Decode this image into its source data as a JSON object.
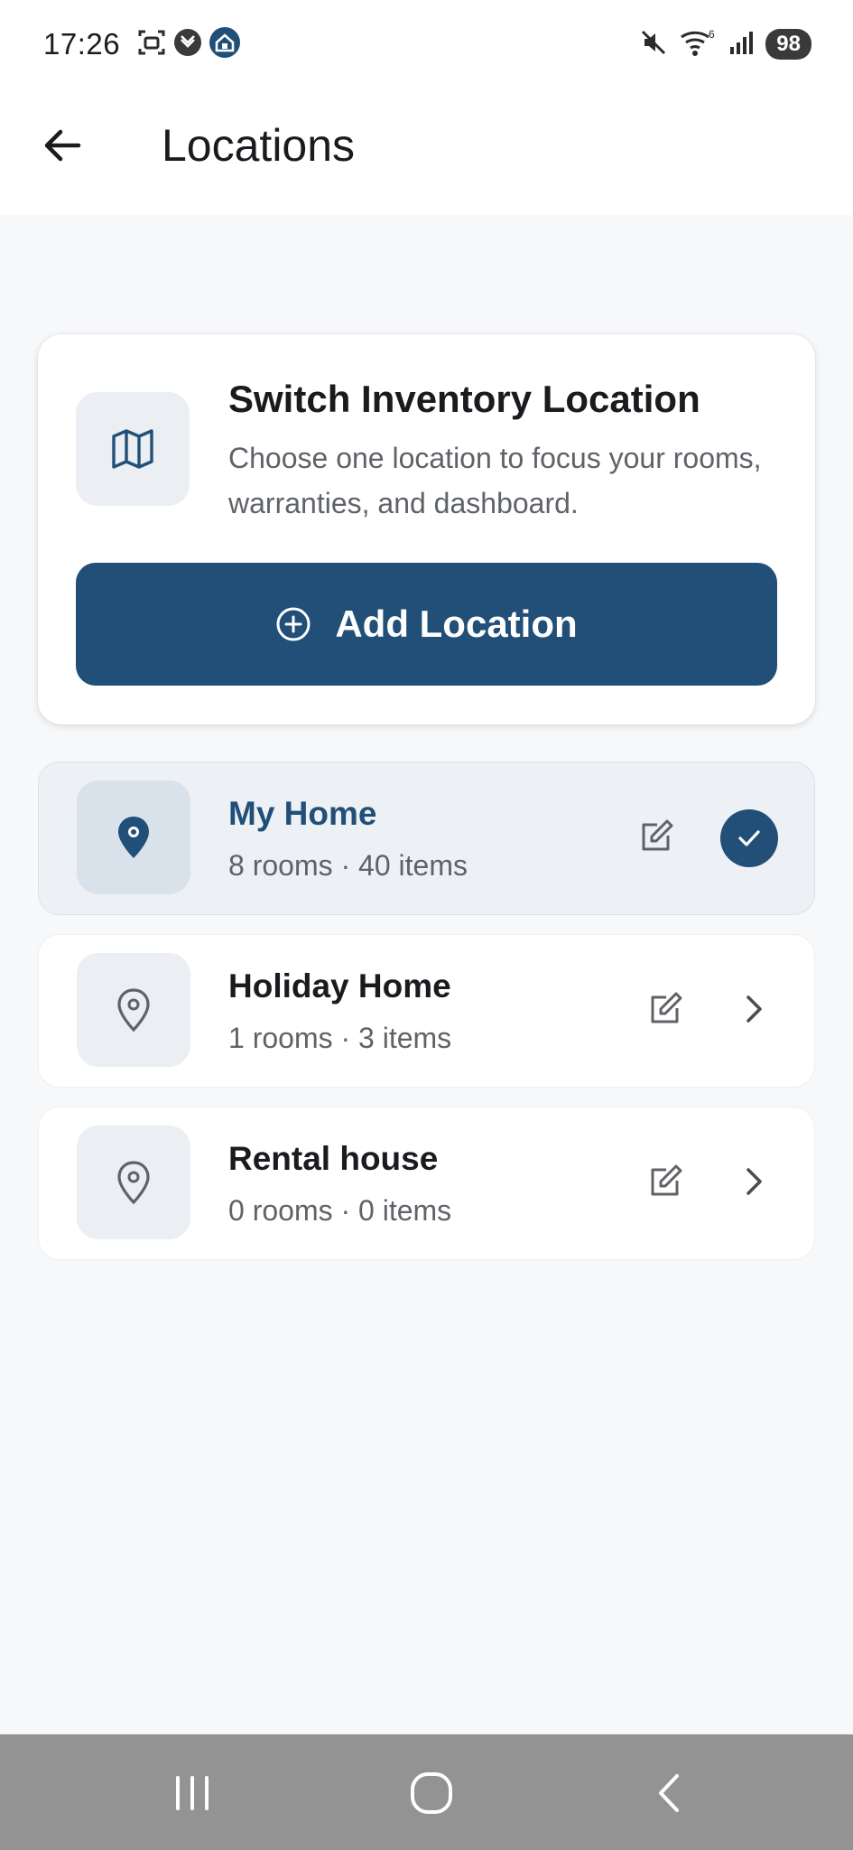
{
  "status_bar": {
    "time": "17:26",
    "battery": "98",
    "icons_left": [
      "screenshot-icon",
      "shield-check-icon",
      "home-app-icon"
    ],
    "icons_right": [
      "mute-icon",
      "wifi-icon",
      "signal-icon"
    ]
  },
  "app_bar": {
    "title": "Locations",
    "back_icon": "arrow-left-icon"
  },
  "switch_card": {
    "title": "Switch Inventory Location",
    "description": "Choose one location to focus your rooms, warranties, and dashboard.",
    "icon": "map-icon",
    "add_button_label": "Add Location",
    "add_button_icon": "plus-circle-icon"
  },
  "locations": [
    {
      "name": "My Home",
      "meta": "8 rooms · 40 items",
      "selected": true
    },
    {
      "name": "Holiday Home",
      "meta": "1 rooms · 3 items",
      "selected": false
    },
    {
      "name": "Rental house",
      "meta": "0 rooms · 0 items",
      "selected": false
    }
  ],
  "colors": {
    "primary": "#214F78",
    "background": "#F7F8FA",
    "selected_card": "#EDF0F4",
    "text_secondary": "#5F6368"
  },
  "nav_bar": {
    "icons": [
      "recent-apps-icon",
      "home-icon",
      "back-icon"
    ]
  }
}
